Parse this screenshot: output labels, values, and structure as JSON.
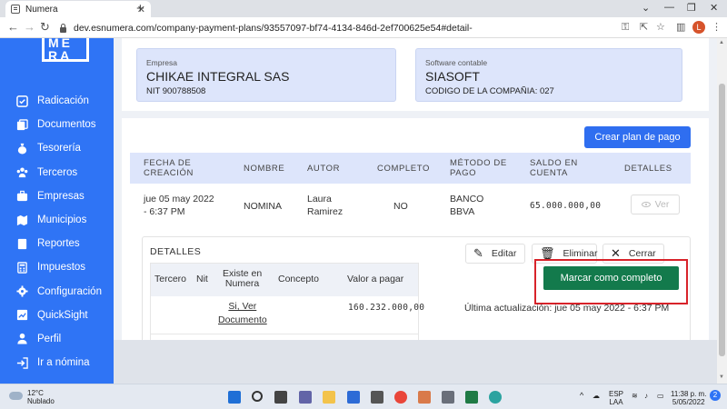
{
  "browser": {
    "tab_title": "Numera",
    "url": "dev.esnumera.com/company-payment-plans/93557097-bf74-4134-846d-2ef700625e54#detail-",
    "profile_initial": "L",
    "profile_color": "#d6532b"
  },
  "sidebar": {
    "logo_line1": "ME",
    "logo_line2": "RA",
    "items": [
      {
        "label": "Radicación",
        "icon": "check-square-icon"
      },
      {
        "label": "Documentos",
        "icon": "documents-icon"
      },
      {
        "label": "Tesorería",
        "icon": "money-bag-icon"
      },
      {
        "label": "Terceros",
        "icon": "users-icon"
      },
      {
        "label": "Empresas",
        "icon": "briefcase-icon"
      },
      {
        "label": "Municipios",
        "icon": "map-icon"
      },
      {
        "label": "Reportes",
        "icon": "book-icon"
      },
      {
        "label": "Impuestos",
        "icon": "calculator-icon"
      },
      {
        "label": "Configuración",
        "icon": "gear-icon"
      },
      {
        "label": "QuickSight",
        "icon": "chart-icon"
      },
      {
        "label": "Perfil",
        "icon": "user-icon"
      },
      {
        "label": "Ir a nómina",
        "icon": "exit-icon"
      }
    ],
    "color": "#2f74f5"
  },
  "company": {
    "label": "Empresa",
    "name": "CHIKAE INTEGRAL SAS",
    "nit": "NIT 900788508"
  },
  "software": {
    "label": "Software contable",
    "name": "SIASOFT",
    "code": "CODIGO DE LA COMPAÑIA: 027"
  },
  "actions": {
    "create_plan": "Crear plan de pago"
  },
  "table": {
    "headers": {
      "fecha_1": "FECHA DE",
      "fecha_2": "CREACIÓN",
      "nombre": "NOMBRE",
      "autor": "AUTOR",
      "completo": "COMPLETO",
      "metodo_1": "MÉTODO DE",
      "metodo_2": "PAGO",
      "saldo_1": "SALDO EN",
      "saldo_2": "CUENTA",
      "detalles": "DETALLES"
    },
    "row": {
      "fecha_1": "jue 05 may 2022",
      "fecha_2": "- 6:37 PM",
      "nombre": "NOMINA",
      "autor_1": "Laura",
      "autor_2": "Ramirez",
      "completo": "NO",
      "metodo_1": "BANCO",
      "metodo_2": "BBVA",
      "saldo": "65.000.000,00",
      "ver": "Ver"
    }
  },
  "details": {
    "title": "DETALLES",
    "edit": "Editar",
    "delete": "Eliminar",
    "close": "Cerrar",
    "headers": {
      "tercero": "Tercero",
      "nit": "Nit",
      "existe_1": "Existe en",
      "existe_2": "Numera",
      "concepto": "Concepto",
      "valor": "Valor a pagar"
    },
    "row": {
      "link_1": "Si, Ver",
      "link_2": "Documento",
      "valor": "160.232.000,00"
    },
    "mark_complete": "Marcar como completo",
    "last_update": "Última actualización: jue 05 may 2022 - 6:37 PM",
    "mark_color": "#137a4c",
    "highlight_color": "#d8232a"
  },
  "taskbar": {
    "temp": "12°C",
    "weather": "Nublado",
    "lang_1": "ESP",
    "lang_2": "LAA",
    "time": "11:38 p. m.",
    "date": "5/05/2022"
  }
}
